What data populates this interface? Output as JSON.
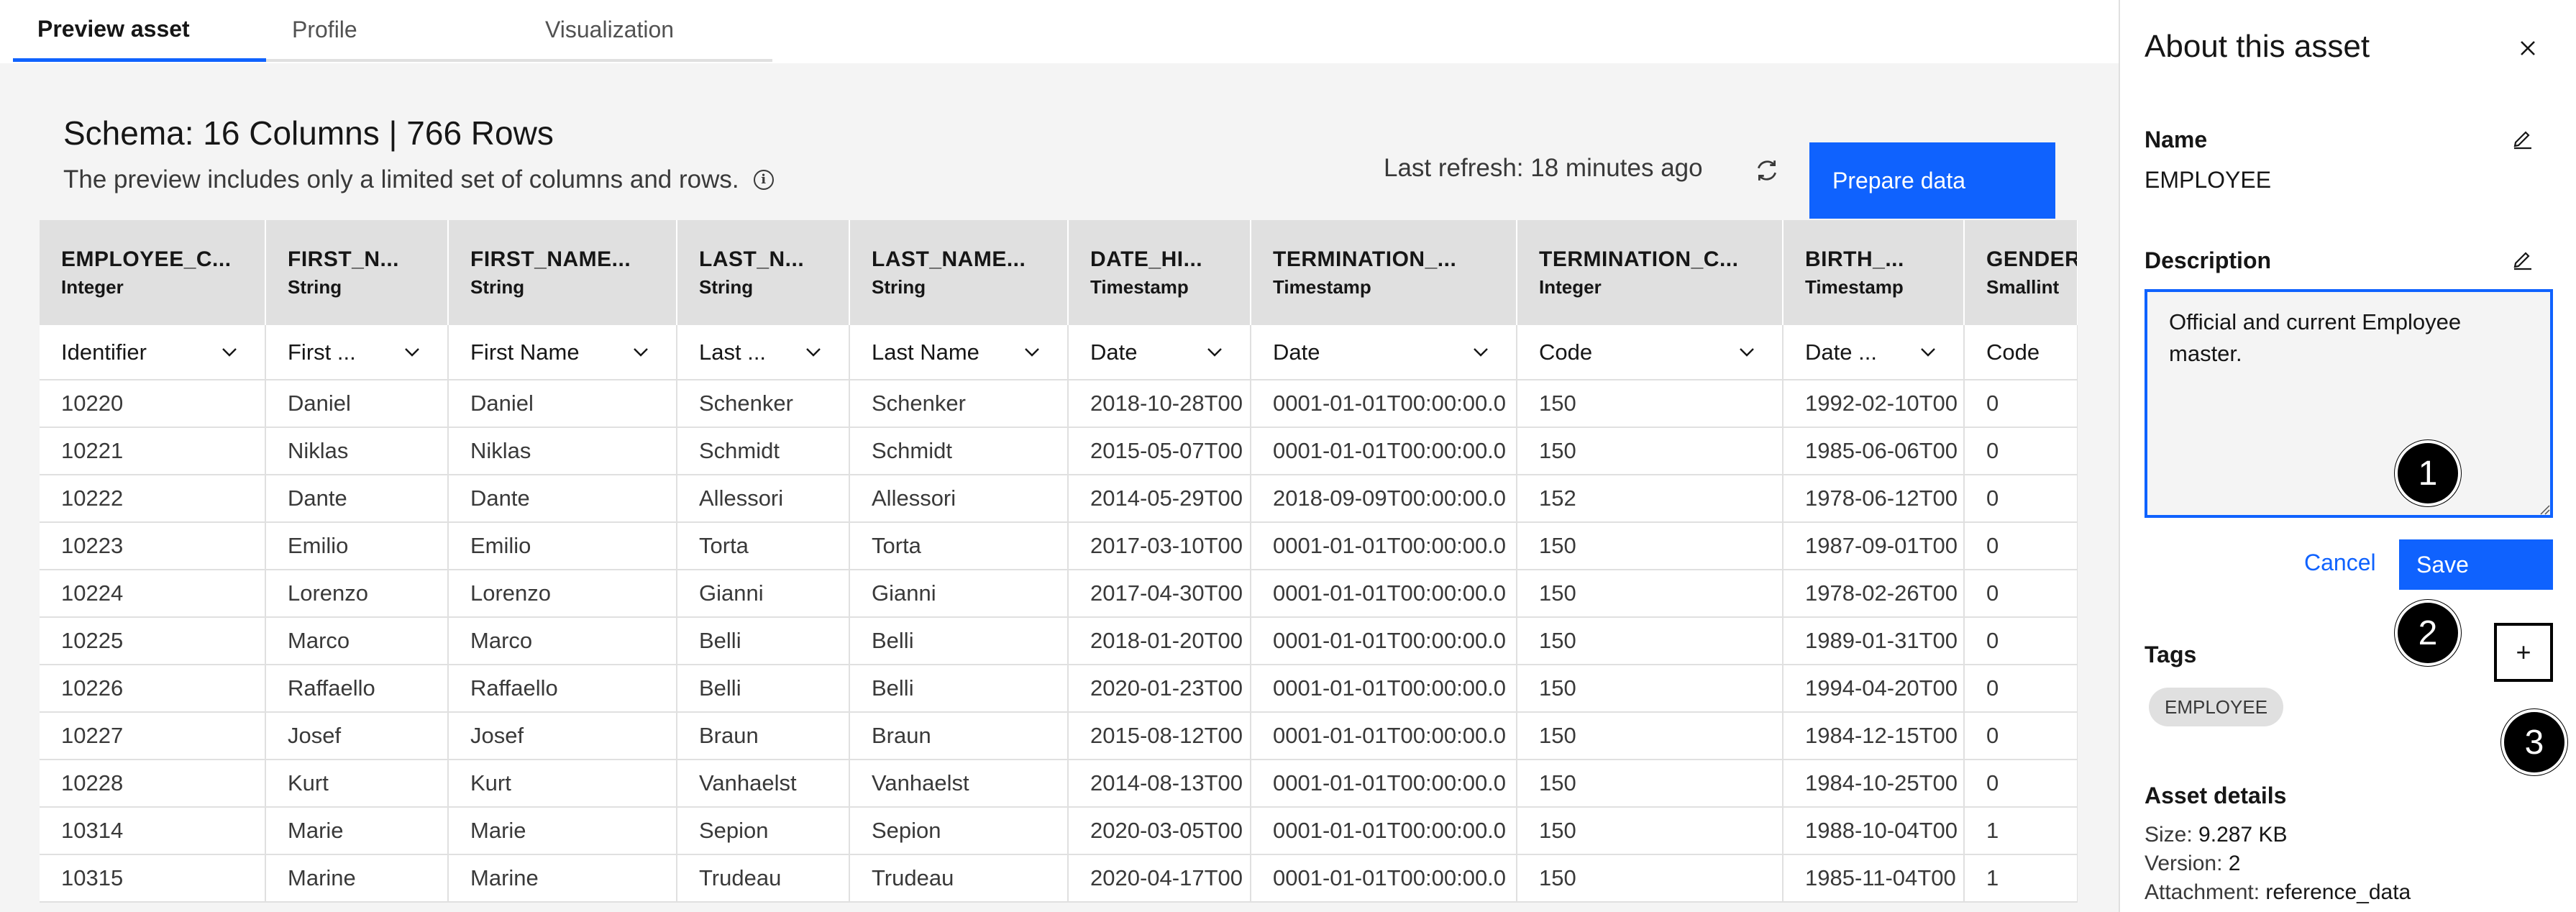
{
  "tabs": [
    "Preview asset",
    "Profile",
    "Visualization"
  ],
  "schema": {
    "title": "Schema:  16 Columns  |  766 Rows",
    "note": "The preview includes only a limited set of columns and rows.",
    "info_icon": "i",
    "last_refresh": "Last refresh: 18 minutes ago",
    "prepare_label": "Prepare data"
  },
  "columns": [
    {
      "name": "EMPLOYEE_C...",
      "type": "Integer",
      "sel": "Identifier",
      "dropdown": true
    },
    {
      "name": "FIRST_N...",
      "type": "String",
      "sel": "First ...",
      "dropdown": true
    },
    {
      "name": "FIRST_NAME...",
      "type": "String",
      "sel": "First Name",
      "dropdown": true
    },
    {
      "name": "LAST_N...",
      "type": "String",
      "sel": "Last ...",
      "dropdown": true
    },
    {
      "name": "LAST_NAME...",
      "type": "String",
      "sel": "Last Name",
      "dropdown": true
    },
    {
      "name": "DATE_HI...",
      "type": "Timestamp",
      "sel": "Date",
      "dropdown": true
    },
    {
      "name": "TERMINATION_...",
      "type": "Timestamp",
      "sel": "Date",
      "dropdown": true
    },
    {
      "name": "TERMINATION_C...",
      "type": "Integer",
      "sel": "Code",
      "dropdown": true
    },
    {
      "name": "BIRTH_...",
      "type": "Timestamp",
      "sel": "Date ...",
      "dropdown": true
    },
    {
      "name": "GENDER",
      "type": "Smallint",
      "sel": "Code",
      "dropdown": false
    }
  ],
  "rows": [
    [
      "10220",
      "Daniel",
      "Daniel",
      "Schenker",
      "Schenker",
      "2018-10-28T00",
      "0001-01-01T00:00:00.0",
      "150",
      "1992-02-10T00",
      "0"
    ],
    [
      "10221",
      "Niklas",
      "Niklas",
      "Schmidt",
      "Schmidt",
      "2015-05-07T00",
      "0001-01-01T00:00:00.0",
      "150",
      "1985-06-06T00",
      "0"
    ],
    [
      "10222",
      "Dante",
      "Dante",
      "Allessori",
      "Allessori",
      "2014-05-29T00",
      "2018-09-09T00:00:00.0",
      "152",
      "1978-06-12T00",
      "0"
    ],
    [
      "10223",
      "Emilio",
      "Emilio",
      "Torta",
      "Torta",
      "2017-03-10T00",
      "0001-01-01T00:00:00.0",
      "150",
      "1987-09-01T00",
      "0"
    ],
    [
      "10224",
      "Lorenzo",
      "Lorenzo",
      "Gianni",
      "Gianni",
      "2017-04-30T00",
      "0001-01-01T00:00:00.0",
      "150",
      "1978-02-26T00",
      "0"
    ],
    [
      "10225",
      "Marco",
      "Marco",
      "Belli",
      "Belli",
      "2018-01-20T00",
      "0001-01-01T00:00:00.0",
      "150",
      "1989-01-31T00",
      "0"
    ],
    [
      "10226",
      "Raffaello",
      "Raffaello",
      "Belli",
      "Belli",
      "2020-01-23T00",
      "0001-01-01T00:00:00.0",
      "150",
      "1994-04-20T00",
      "0"
    ],
    [
      "10227",
      "Josef",
      "Josef",
      "Braun",
      "Braun",
      "2015-08-12T00",
      "0001-01-01T00:00:00.0",
      "150",
      "1984-12-15T00",
      "0"
    ],
    [
      "10228",
      "Kurt",
      "Kurt",
      "Vanhaelst",
      "Vanhaelst",
      "2014-08-13T00",
      "0001-01-01T00:00:00.0",
      "150",
      "1984-10-25T00",
      "0"
    ],
    [
      "10314",
      "Marie",
      "Marie",
      "Sepion",
      "Sepion",
      "2020-03-05T00",
      "0001-01-01T00:00:00.0",
      "150",
      "1988-10-04T00",
      "1"
    ],
    [
      "10315",
      "Marine",
      "Marine",
      "Trudeau",
      "Trudeau",
      "2020-04-17T00",
      "0001-01-01T00:00:00.0",
      "150",
      "1985-11-04T00",
      "1"
    ]
  ],
  "panel": {
    "title": "About this asset",
    "name_label": "Name",
    "name_value": "EMPLOYEE",
    "description_label": "Description",
    "description_value": "Official and current Employee master.",
    "cancel_label": "Cancel",
    "save_label": "Save",
    "tags_label": "Tags",
    "add_tag_label": "+",
    "tag": "EMPLOYEE",
    "details_label": "Asset details",
    "size_label": "Size:",
    "size_value": "9.287 KB",
    "version_label": "Version:",
    "version_value": "2",
    "attachment_label": "Attachment:",
    "attachment_value": "reference_data"
  },
  "callouts": [
    "1",
    "2",
    "3"
  ],
  "icons": [
    "info-icon",
    "refresh-icon",
    "chevron-down-icon",
    "close-icon",
    "edit-icon",
    "resize-grip-icon"
  ],
  "colors": {
    "accent": "#0f62fe",
    "header_bg": "#e0e0e0",
    "content_bg": "#f4f4f4"
  }
}
